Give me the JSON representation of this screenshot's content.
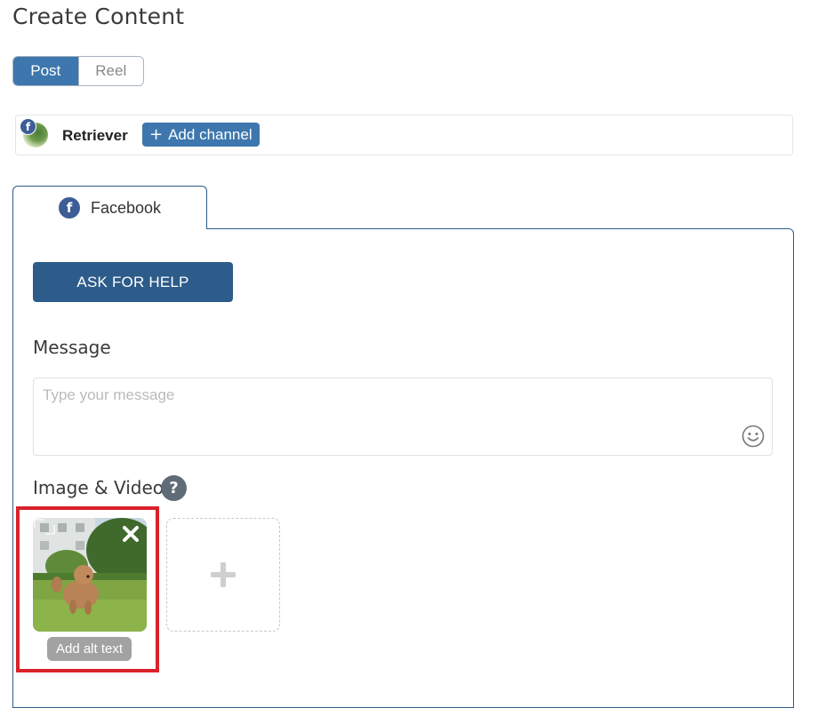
{
  "page": {
    "title": "Create Content"
  },
  "content_type": {
    "options": [
      "Post",
      "Reel"
    ],
    "selected": "Post"
  },
  "channels": {
    "items": [
      {
        "name": "Retriever",
        "network": "facebook"
      }
    ],
    "add_label": "Add channel"
  },
  "tabs": [
    {
      "label": "Facebook",
      "icon": "facebook-icon",
      "active": true
    }
  ],
  "editor": {
    "ask_help_label": "ASK FOR HELP",
    "message_label": "Message",
    "message_placeholder": "Type your message",
    "message_value": "",
    "media_label": "Image & Video",
    "help_icon": "?",
    "alt_text_label": "Add alt text"
  },
  "colors": {
    "primary": "#3d77ad",
    "dark_primary": "#2d5b8a",
    "facebook": "#3d5d96",
    "highlight": "#d9222a"
  }
}
